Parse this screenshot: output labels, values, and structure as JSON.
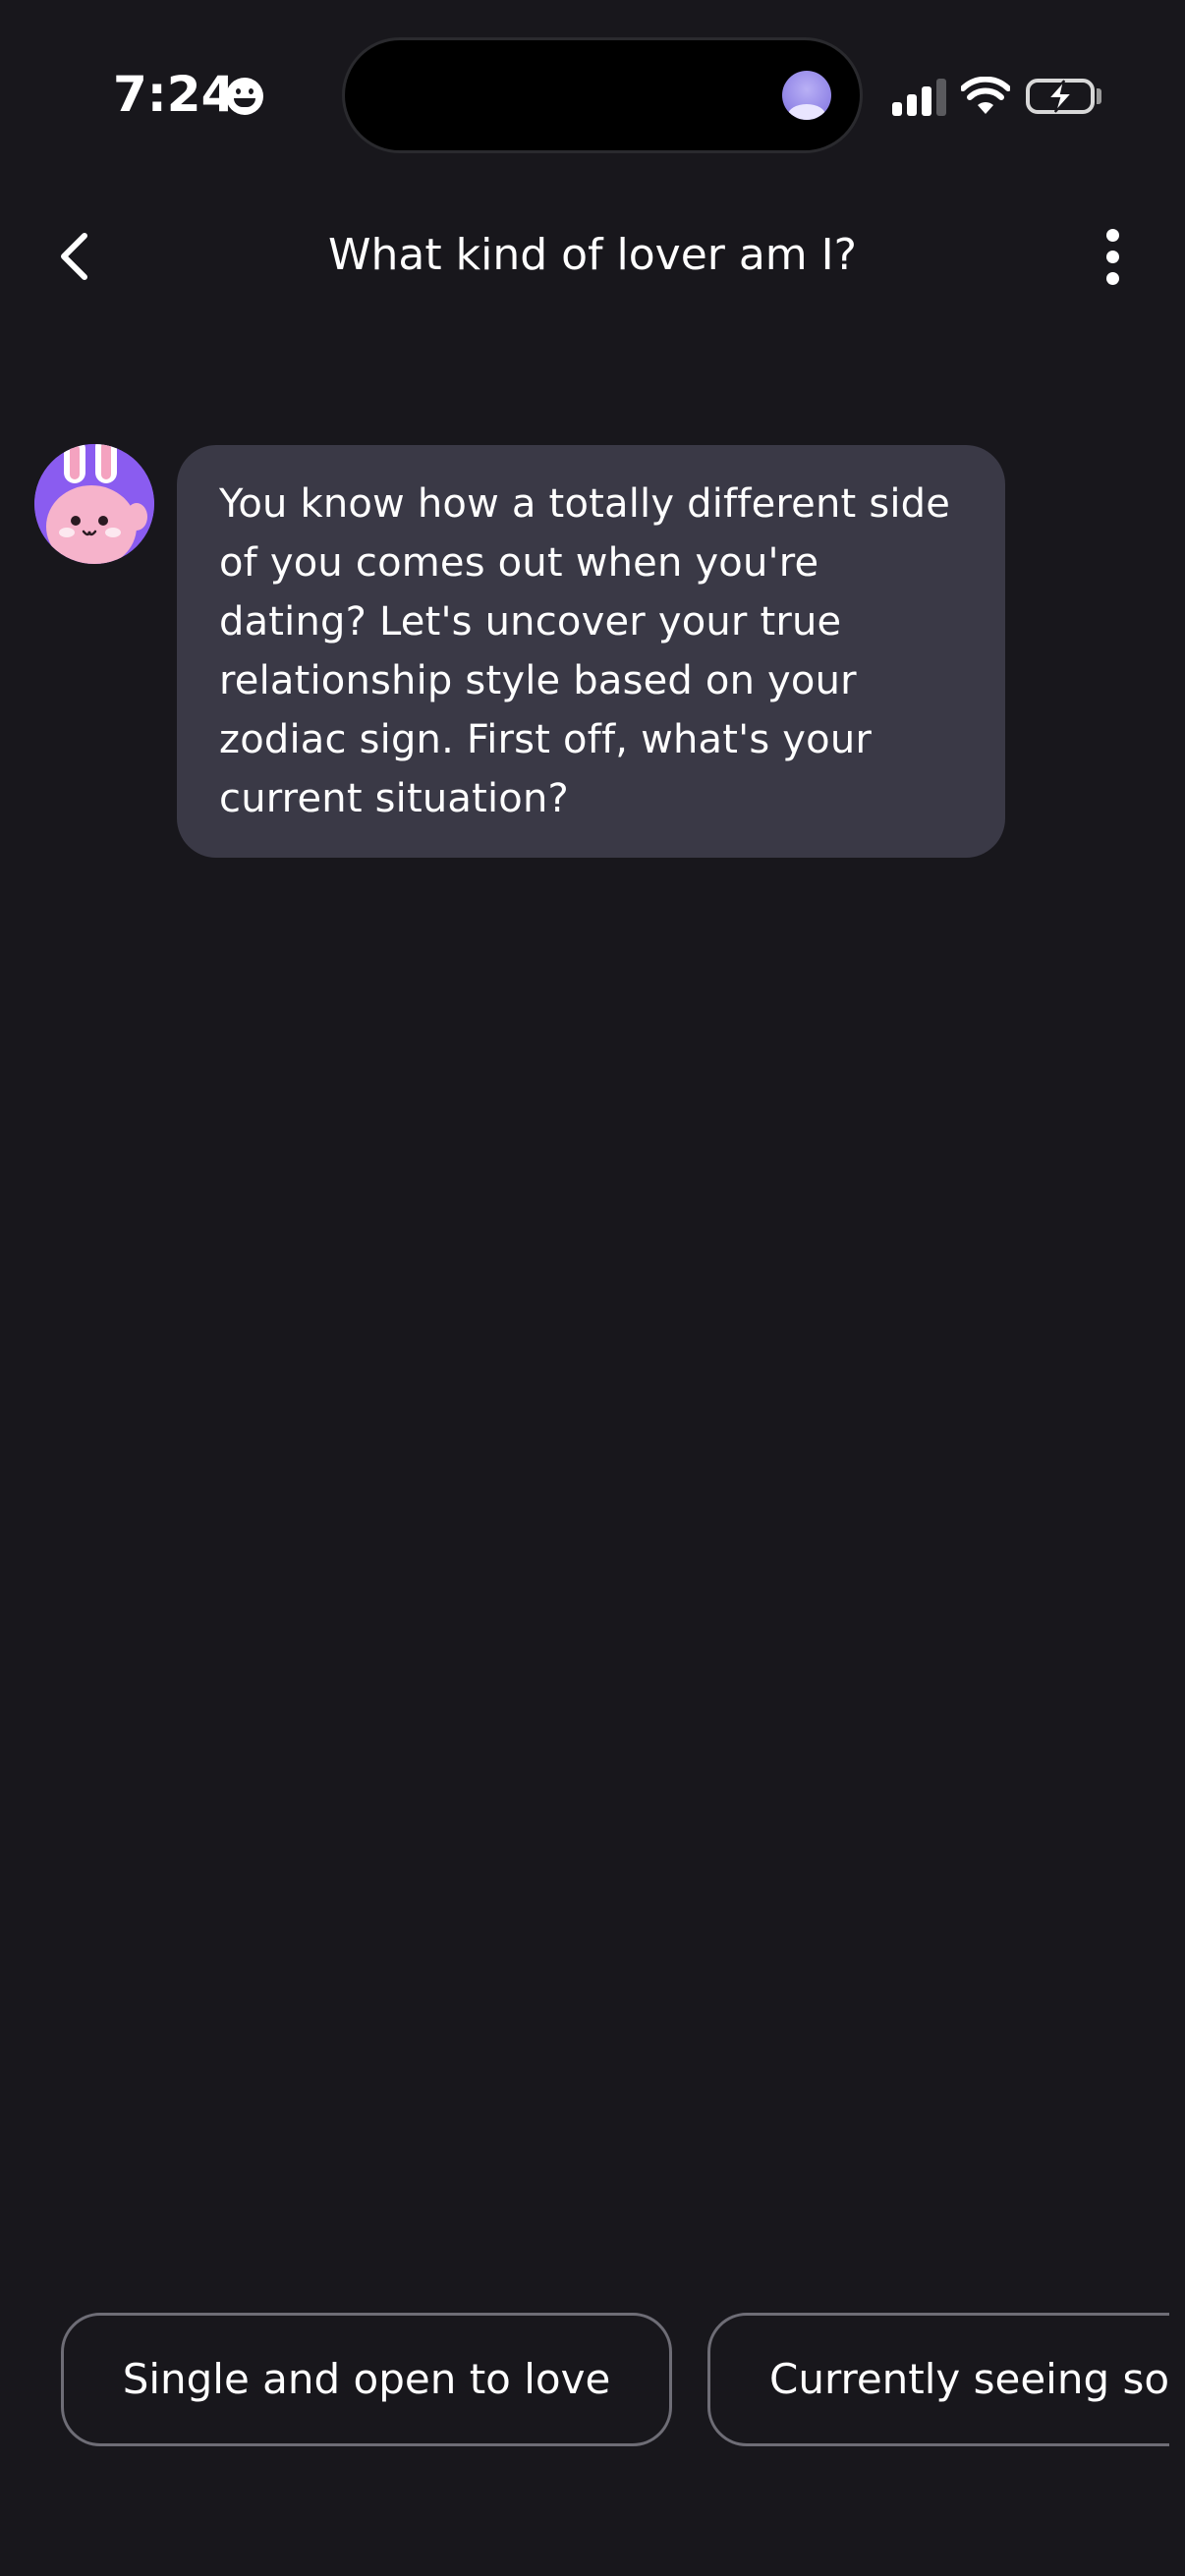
{
  "status_bar": {
    "time": "7:24",
    "icons": [
      "smiley-icon",
      "signal-icon",
      "wifi-icon",
      "battery-charging-icon"
    ]
  },
  "header": {
    "title": "What kind of lover am I?",
    "back_icon": "chevron-left-icon",
    "more_icon": "more-vertical-icon"
  },
  "chat": {
    "messages": [
      {
        "sender_avatar": "bunny-avatar",
        "text": "You know how a totally different side of you comes out when you're dating? Let's uncover your true relationship style based on your zodiac sign. First off, what's your current situation?"
      }
    ]
  },
  "quick_replies": [
    {
      "label": "Single and open to love"
    },
    {
      "label": "Currently seeing so"
    }
  ],
  "colors": {
    "background": "#18171c",
    "bubble": "#3a3946",
    "chip_border": "#6e6d76",
    "avatar_bg": "#8a5cf0",
    "bunny_pink": "#f4a3c0"
  }
}
